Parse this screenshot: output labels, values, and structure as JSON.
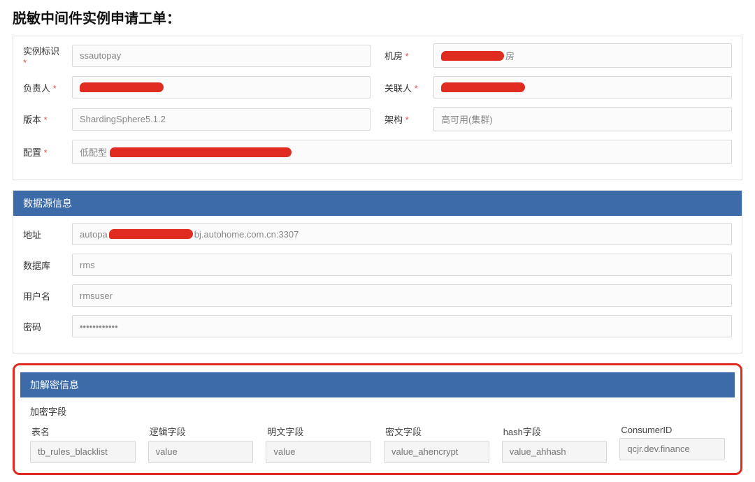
{
  "page_title": "脱敏中间件实例申请工单：",
  "form": {
    "instance_id": {
      "label": "实例标识",
      "required": true,
      "value": "ssautopay"
    },
    "machine_room": {
      "label": "机房",
      "required": true,
      "suffix": "房"
    },
    "owner": {
      "label": "负责人",
      "required": true
    },
    "contact": {
      "label": "关联人",
      "required": true
    },
    "version": {
      "label": "版本",
      "required": true,
      "value": "ShardingSphere5.1.2"
    },
    "arch": {
      "label": "架构",
      "required": true,
      "value": "高可用(集群)"
    },
    "config": {
      "label": "配置",
      "required": true,
      "prefix": "低配型"
    }
  },
  "datasource": {
    "header": "数据源信息",
    "address": {
      "label": "地址",
      "prefix": "autopa",
      "suffix": "bj.autohome.com.cn:3307"
    },
    "database": {
      "label": "数据库",
      "value": "rms"
    },
    "username": {
      "label": "用户名",
      "value": "rmsuser"
    },
    "password": {
      "label": "密码",
      "value": "••••••••••••"
    }
  },
  "crypto": {
    "header": "加解密信息",
    "section_label": "加密字段",
    "columns": [
      {
        "label": "表名",
        "value": "tb_rules_blacklist"
      },
      {
        "label": "逻辑字段",
        "value": "value"
      },
      {
        "label": "明文字段",
        "value": "value"
      },
      {
        "label": "密文字段",
        "value": "value_ahencrypt"
      },
      {
        "label": "hash字段",
        "value": "value_ahhash"
      },
      {
        "label": "ConsumerID",
        "value": "qcjr.dev.finance"
      }
    ]
  }
}
